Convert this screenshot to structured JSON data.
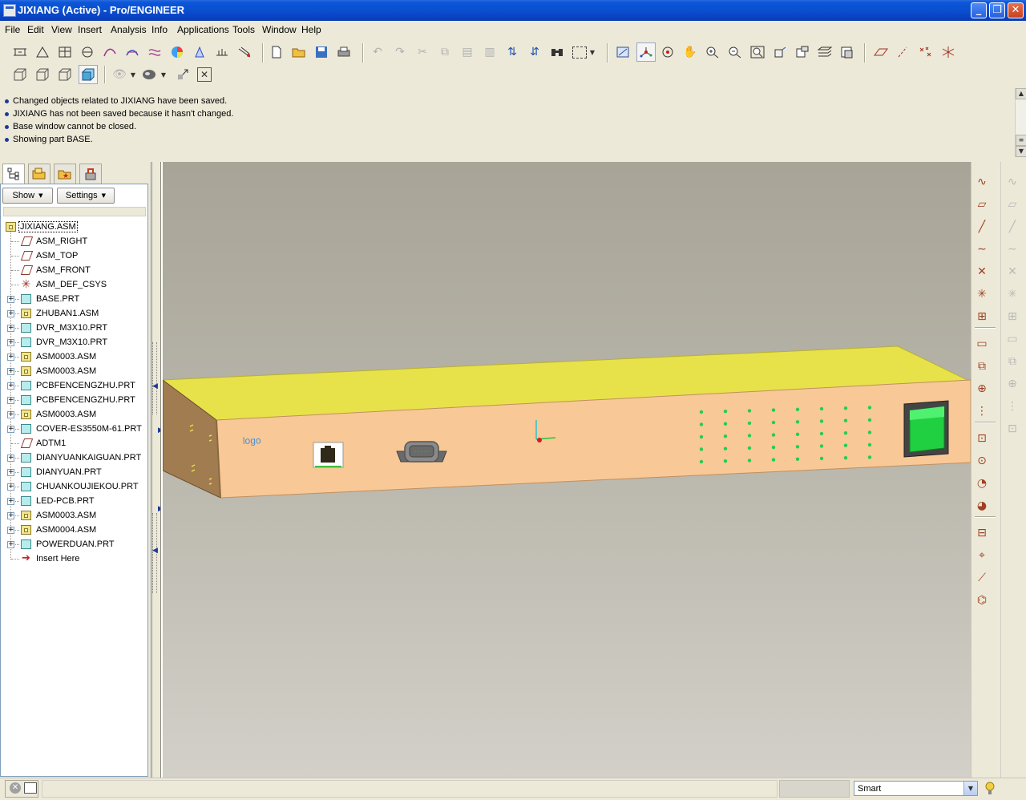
{
  "window": {
    "title": "JIXIANG (Active) - Pro/ENGINEER",
    "buttons": [
      "minimize",
      "restore",
      "close"
    ]
  },
  "menu": {
    "items": [
      "File",
      "Edit",
      "View",
      "Insert",
      "Analysis",
      "Info",
      "Applications",
      "Tools",
      "Window",
      "Help"
    ]
  },
  "toolbar": {
    "row1_icons": [
      "measure-icon",
      "area-icon",
      "section-icon",
      "datum-plane-display-icon",
      "curve-analysis-icon",
      "surface-analysis-icon",
      "curvature-icon",
      "color-analysis-icon",
      "draft-icon",
      "dihedral-icon",
      "shade-icon",
      "new-file-icon",
      "open-file-icon",
      "save-icon",
      "print-icon",
      "undo-icon",
      "redo-icon",
      "cut-icon",
      "copy-icon",
      "paste-icon",
      "paste-special-icon",
      "regenerate-icon",
      "regen-manager-icon",
      "find-icon",
      "select-box-icon",
      "repaint-icon",
      "spin-center-icon",
      "orient-mode-icon",
      "pan-icon",
      "zoom-in-icon",
      "zoom-out-icon",
      "refit-icon",
      "reorient-icon",
      "saved-views-icon",
      "layers-icon",
      "view-manager-icon",
      "datum-planes-icon",
      "datum-axes-icon",
      "datum-points-icon",
      "datum-csys-icon"
    ],
    "row2_icons": [
      "wireframe-icon",
      "hidden-line-icon",
      "no-hidden-icon",
      "shading-icon",
      "visibility-icon",
      "appearance-icon",
      "model-display-icon",
      "close-window-icon"
    ]
  },
  "messages": [
    "Changed objects related to JIXIANG have been saved.",
    "JIXIANG has not been saved because it hasn't changed.",
    "Base window cannot be closed.",
    "Showing part BASE."
  ],
  "model_tree": {
    "tabs": [
      "model-tree-tab",
      "folder-browser-tab",
      "favorites-tab",
      "connections-tab"
    ],
    "show_label": "Show",
    "settings_label": "Settings",
    "items": [
      {
        "label": "JIXIANG.ASM",
        "type": "asm",
        "expandable": false
      },
      {
        "label": "ASM_RIGHT",
        "type": "datum",
        "expandable": false
      },
      {
        "label": "ASM_TOP",
        "type": "datum",
        "expandable": false
      },
      {
        "label": "ASM_FRONT",
        "type": "datum",
        "expandable": false
      },
      {
        "label": "ASM_DEF_CSYS",
        "type": "csys",
        "expandable": false
      },
      {
        "label": "BASE.PRT",
        "type": "prt",
        "expandable": true
      },
      {
        "label": "ZHUBAN1.ASM",
        "type": "asm",
        "expandable": true
      },
      {
        "label": "DVR_M3X10.PRT",
        "type": "prt",
        "expandable": true
      },
      {
        "label": "DVR_M3X10.PRT",
        "type": "prt",
        "expandable": true
      },
      {
        "label": "ASM0003.ASM",
        "type": "asm",
        "expandable": true
      },
      {
        "label": "ASM0003.ASM",
        "type": "asm",
        "expandable": true
      },
      {
        "label": "PCBFENCENGZHU.PRT",
        "type": "prt",
        "expandable": true
      },
      {
        "label": "PCBFENCENGZHU.PRT",
        "type": "prt",
        "expandable": true
      },
      {
        "label": "ASM0003.ASM",
        "type": "asm",
        "expandable": true
      },
      {
        "label": "COVER-ES3550M-61.PRT",
        "type": "prt",
        "expandable": true
      },
      {
        "label": "ADTM1",
        "type": "datum",
        "expandable": false
      },
      {
        "label": "DIANYUANKAIGUAN.PRT",
        "type": "prt",
        "expandable": true
      },
      {
        "label": "DIANYUAN.PRT",
        "type": "prt",
        "expandable": true
      },
      {
        "label": "CHUANKOUJIEKOU.PRT",
        "type": "prt",
        "expandable": true
      },
      {
        "label": "LED-PCB.PRT",
        "type": "prt",
        "expandable": true
      },
      {
        "label": "ASM0003.ASM",
        "type": "asm",
        "expandable": true
      },
      {
        "label": "ASM0004.ASM",
        "type": "asm",
        "expandable": true
      },
      {
        "label": "POWERDUAN.PRT",
        "type": "prt",
        "expandable": true
      },
      {
        "label": "Insert Here",
        "type": "insert",
        "expandable": false
      }
    ]
  },
  "viewport": {
    "logo_text": "logo",
    "colors": {
      "top_face": "#e8e24a",
      "front_face": "#f8c896",
      "side_face": "#a07c50",
      "switch": "#20d040",
      "led": "#20d050"
    }
  },
  "right_toolbar": {
    "left_icons": [
      "sketch-datum-curve-icon",
      "datum-plane-tool-icon",
      "datum-axis-tool-icon",
      "datum-curve-tool-icon",
      "datum-point-tool-icon",
      "csys-tool-icon",
      "analysis-feature-icon",
      "sketch-tool-icon",
      "component-place-icon",
      "component-create-icon",
      "pattern-icon",
      "assembly-cut-icon",
      "hole-icon",
      "round-icon",
      "chamfer-icon",
      "copy-icon",
      "mirror-icon",
      "merge-icon",
      "surface-edit-icon"
    ],
    "right_icons": [
      "mirror-dim-icon",
      "extrude-dim-icon",
      "revolve-dim-icon",
      "pattern-dim-icon",
      "style-icon",
      "boundary-icon",
      "shell-icon",
      "rib-icon",
      "draft-dim-icon",
      "offset-dim-icon",
      "trim-dim-icon",
      "thicken-dim-icon"
    ]
  },
  "status": {
    "filter_value": "Smart"
  }
}
